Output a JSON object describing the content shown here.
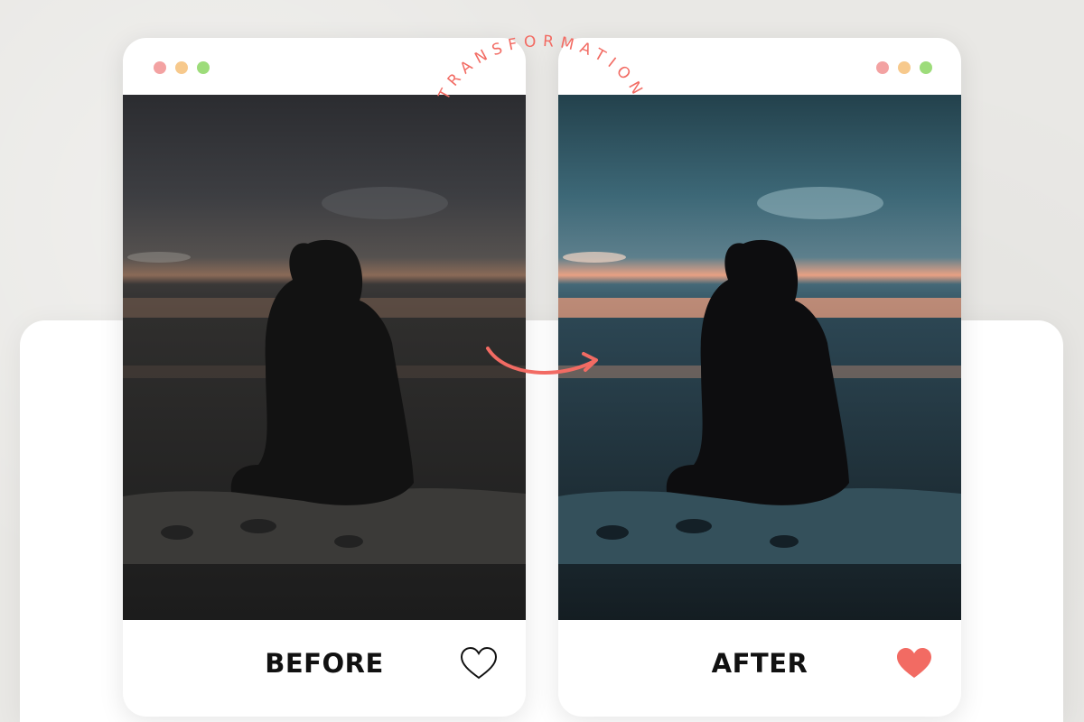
{
  "colors": {
    "accent": "#f26b63",
    "card_background": "#ffffff",
    "page_background": "#e9e8e5"
  },
  "transformation_label": "TRANSFORMATION",
  "before_card": {
    "window_dots": [
      "red-dot",
      "yellow-dot",
      "green-dot"
    ],
    "caption": "BEFORE",
    "like_icon": "heart-outline-icon"
  },
  "after_card": {
    "window_dots": [
      "red-dot",
      "yellow-dot",
      "green-dot"
    ],
    "caption": "AFTER",
    "like_icon": "heart-filled-icon"
  },
  "arrow_icon": "curved-arrow-icon"
}
